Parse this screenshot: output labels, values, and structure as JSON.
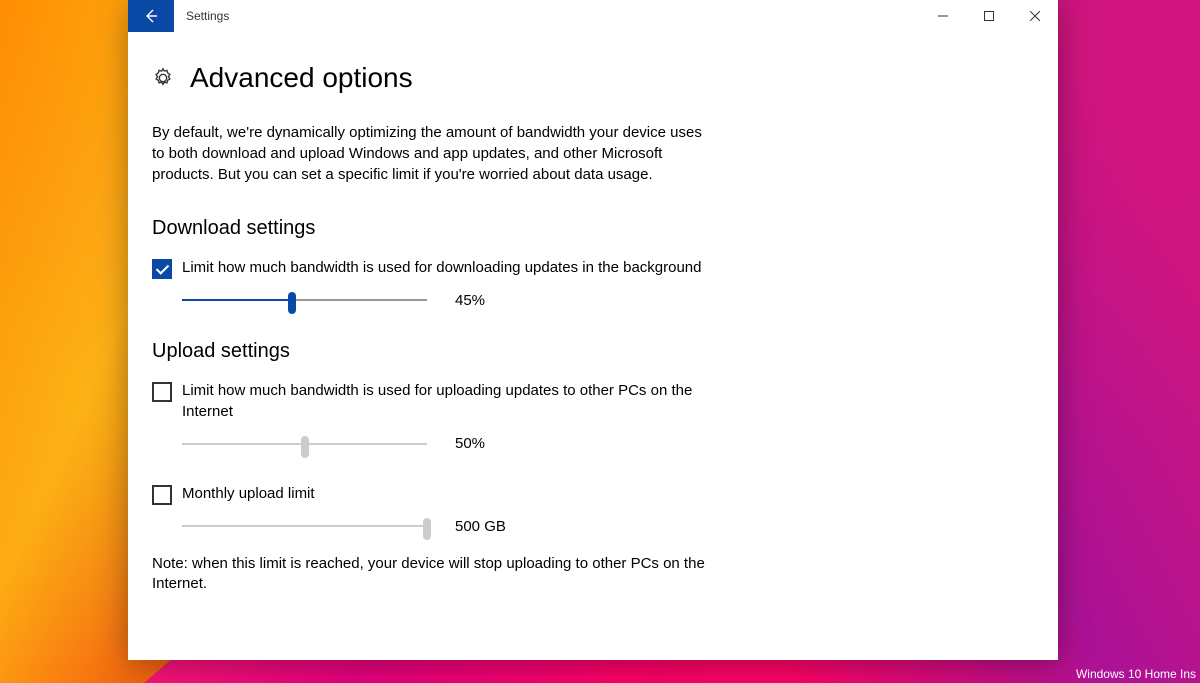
{
  "window": {
    "title": "Settings"
  },
  "page": {
    "heading": "Advanced options",
    "description": "By default, we're dynamically optimizing the amount of bandwidth your device uses to both download and upload Windows and app updates, and other Microsoft products. But you can set a specific limit if you're worried about data usage."
  },
  "download": {
    "section_title": "Download settings",
    "limit_label": "Limit how much bandwidth is used for downloading updates in the background",
    "limit_checked": true,
    "slider_percent": 45,
    "slider_display": "45%"
  },
  "upload": {
    "section_title": "Upload settings",
    "limit_label": "Limit how much bandwidth is used for uploading updates to other PCs on the Internet",
    "limit_checked": false,
    "bw_slider_percent": 50,
    "bw_slider_display": "50%",
    "monthly_label": "Monthly upload limit",
    "monthly_checked": false,
    "monthly_slider_percent": 100,
    "monthly_slider_display": "500 GB",
    "note": "Note: when this limit is reached, your device will stop uploading to other PCs on the Internet."
  },
  "desktop": {
    "watermark": "Windows 10 Home Ins"
  }
}
